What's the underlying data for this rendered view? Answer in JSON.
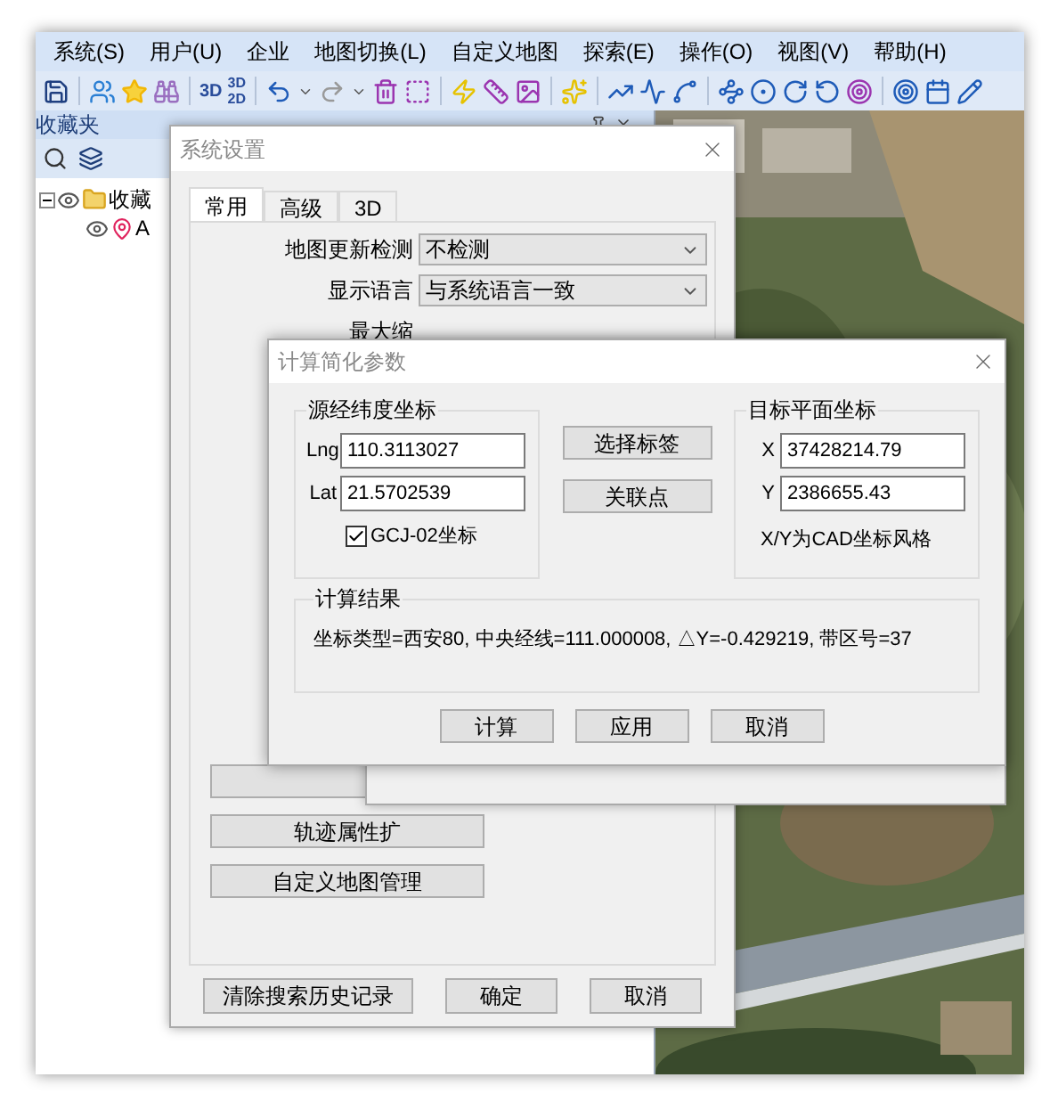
{
  "menu": [
    "系统(S)",
    "用户(U)",
    "企业",
    "地图切换(L)",
    "自定义地图",
    "探索(E)",
    "操作(O)",
    "视图(V)",
    "帮助(H)"
  ],
  "toolbar": {
    "text_buttons": [
      "3D"
    ],
    "stacked_button": {
      "top": "3D",
      "bottom": "2D"
    }
  },
  "favorites_panel": {
    "title": "收藏夹",
    "tree": [
      {
        "label": "收藏",
        "expanded": true,
        "children": [
          {
            "label": "A"
          }
        ]
      }
    ]
  },
  "settings_dialog": {
    "title": "系统设置",
    "tabs": [
      {
        "label": "常用",
        "selected": true
      },
      {
        "label": "高级",
        "selected": false
      },
      {
        "label": "3D",
        "selected": false
      }
    ],
    "fields": [
      {
        "label": "地图更新检测",
        "value": "不检测"
      },
      {
        "label": "显示语言",
        "value": "与系统语言一致"
      },
      {
        "label": "最大缩"
      }
    ],
    "side_buttons": [
      "轨迹属性扩",
      "自定义地图管理"
    ],
    "footer_buttons": [
      "清除搜索历史记录",
      "确定",
      "取消"
    ]
  },
  "calc_dialog": {
    "title": "计算简化参数",
    "source_group": {
      "title": "源经纬度坐标",
      "fields": [
        {
          "label": "Lng",
          "value": "110.3113027"
        },
        {
          "label": "Lat",
          "value": "21.5702539"
        }
      ],
      "checkbox": {
        "label": "GCJ-02坐标",
        "checked": true
      }
    },
    "middle_buttons": [
      "选择标签",
      "关联点"
    ],
    "target_group": {
      "title": "目标平面坐标",
      "fields": [
        {
          "label": "X",
          "value": "37428214.79"
        },
        {
          "label": "Y",
          "value": "2386655.43"
        }
      ],
      "note": "X/Y为CAD坐标风格"
    },
    "result_group": {
      "title": "计算结果",
      "text": "坐标类型=西安80, 中央经线=111.000008, △Y=-0.429219, 带区号=37"
    },
    "buttons": [
      "计算",
      "应用",
      "取消"
    ]
  }
}
